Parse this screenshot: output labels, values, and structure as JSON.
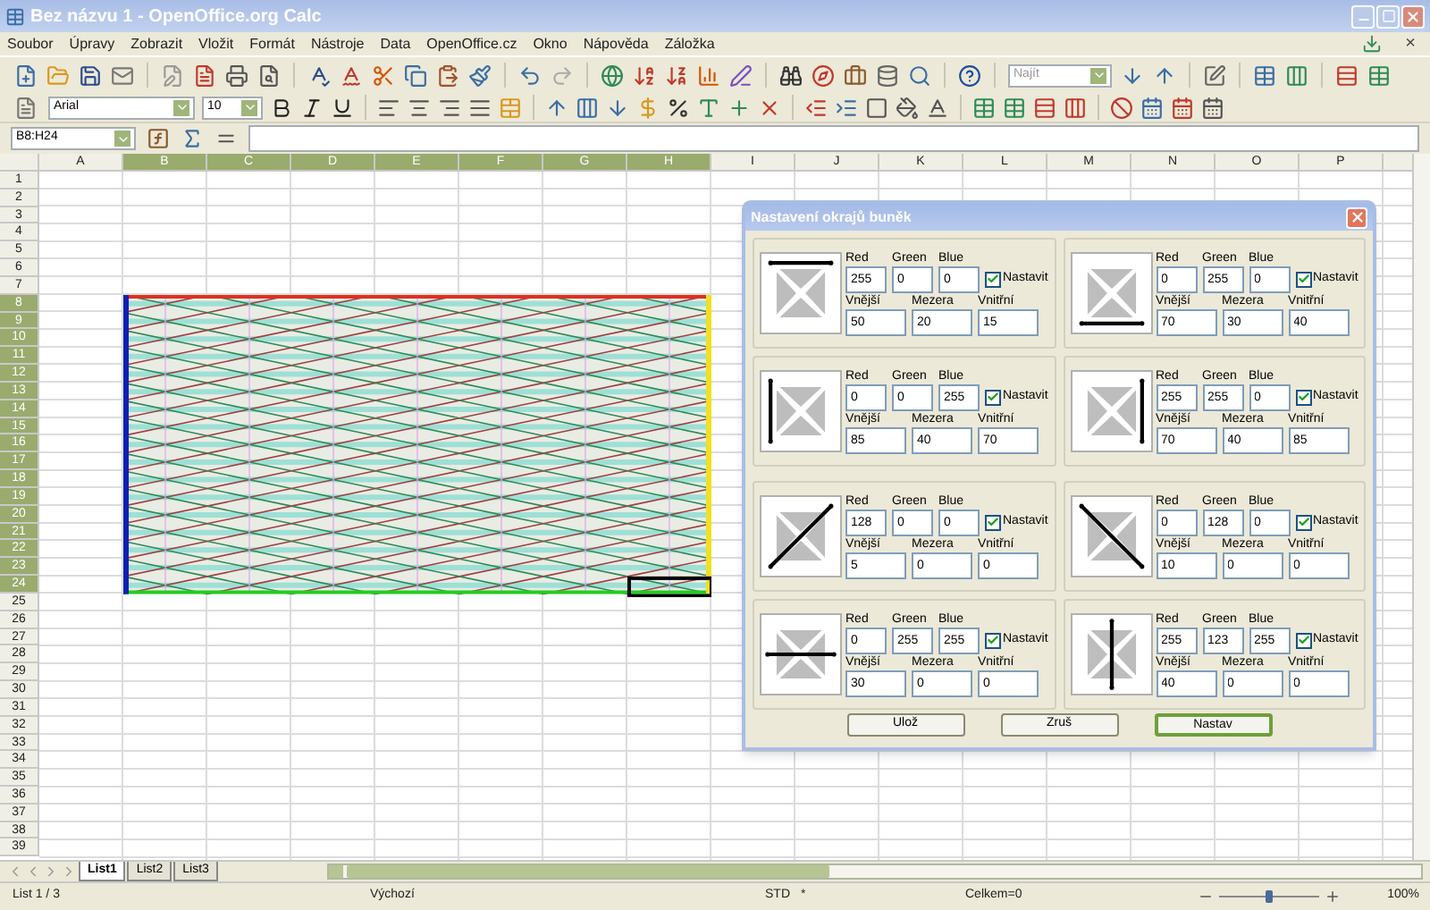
{
  "window": {
    "title": "Bez názvu 1 - OpenOffice.org Calc",
    "doc_close": "×"
  },
  "menu": [
    "Soubor",
    "Úpravy",
    "Zobrazit",
    "Vložit",
    "Formát",
    "Nástroje",
    "Data",
    "OpenOffice.cz",
    "Okno",
    "Nápověda",
    "Záložka"
  ],
  "toolbar": {
    "search_placeholder": "Najít",
    "font": "Arial",
    "size": "10"
  },
  "formula_bar": {
    "name_box": "B8:H24"
  },
  "columns": [
    {
      "label": "A",
      "selected": false
    },
    {
      "label": "B",
      "selected": true
    },
    {
      "label": "C",
      "selected": true
    },
    {
      "label": "D",
      "selected": true
    },
    {
      "label": "E",
      "selected": true
    },
    {
      "label": "F",
      "selected": true
    },
    {
      "label": "G",
      "selected": true
    },
    {
      "label": "H",
      "selected": true
    },
    {
      "label": "I",
      "selected": false
    },
    {
      "label": "J",
      "selected": false
    },
    {
      "label": "K",
      "selected": false
    },
    {
      "label": "L",
      "selected": false
    },
    {
      "label": "M",
      "selected": false
    },
    {
      "label": "N",
      "selected": false
    },
    {
      "label": "O",
      "selected": false
    },
    {
      "label": "P",
      "selected": false
    }
  ],
  "rows": [
    {
      "label": "1",
      "selected": false
    },
    {
      "label": "2",
      "selected": false
    },
    {
      "label": "3",
      "selected": false
    },
    {
      "label": "4",
      "selected": false
    },
    {
      "label": "5",
      "selected": false
    },
    {
      "label": "6",
      "selected": false
    },
    {
      "label": "7",
      "selected": false
    },
    {
      "label": "8",
      "selected": true
    },
    {
      "label": "9",
      "selected": true
    },
    {
      "label": "10",
      "selected": true
    },
    {
      "label": "11",
      "selected": true
    },
    {
      "label": "12",
      "selected": true
    },
    {
      "label": "13",
      "selected": true
    },
    {
      "label": "14",
      "selected": true
    },
    {
      "label": "15",
      "selected": true
    },
    {
      "label": "16",
      "selected": true
    },
    {
      "label": "17",
      "selected": true
    },
    {
      "label": "18",
      "selected": true
    },
    {
      "label": "19",
      "selected": true
    },
    {
      "label": "20",
      "selected": true
    },
    {
      "label": "21",
      "selected": true
    },
    {
      "label": "22",
      "selected": true
    },
    {
      "label": "23",
      "selected": true
    },
    {
      "label": "24",
      "selected": true
    },
    {
      "label": "25",
      "selected": false
    },
    {
      "label": "26",
      "selected": false
    },
    {
      "label": "27",
      "selected": false
    },
    {
      "label": "28",
      "selected": false
    },
    {
      "label": "29",
      "selected": false
    },
    {
      "label": "30",
      "selected": false
    },
    {
      "label": "31",
      "selected": false
    },
    {
      "label": "32",
      "selected": false
    },
    {
      "label": "33",
      "selected": false
    },
    {
      "label": "34",
      "selected": false
    },
    {
      "label": "35",
      "selected": false
    },
    {
      "label": "36",
      "selected": false
    },
    {
      "label": "37",
      "selected": false
    },
    {
      "label": "38",
      "selected": false
    },
    {
      "label": "39",
      "selected": false
    }
  ],
  "sheet_tabs": [
    {
      "label": "List1",
      "selected": true
    },
    {
      "label": "List2",
      "selected": false
    },
    {
      "label": "List3",
      "selected": false
    }
  ],
  "status_bar": {
    "sheet": "List 1 / 3",
    "style": "Výchozí",
    "mode": "STD",
    "modified": "*",
    "sum": "Celkem=0",
    "zoom": {
      "level": 0.5,
      "reading": "100%"
    }
  },
  "dialog": {
    "title": "Nastavení okrajů buněk",
    "panels": [
      {
        "kind": "top",
        "red": "255",
        "green": "0",
        "blue": "0",
        "checked": true,
        "outer": "50",
        "gap": "20",
        "inner": "15",
        "labels": [
          "Red",
          "Green",
          "Blue",
          "Nastavit",
          "Vnější",
          "Mezera",
          "Vnitřní"
        ]
      },
      {
        "kind": "bottom",
        "red": "0",
        "green": "255",
        "blue": "0",
        "checked": true,
        "outer": "70",
        "gap": "30",
        "inner": "40",
        "labels": [
          "Red",
          "Green",
          "Blue",
          "Nastavit",
          "Vnější",
          "Mezera",
          "Vnitřní"
        ]
      },
      {
        "kind": "left",
        "red": "0",
        "green": "0",
        "blue": "255",
        "checked": true,
        "outer": "85",
        "gap": "40",
        "inner": "70",
        "labels": [
          "Red",
          "Green",
          "Blue",
          "Nastavit",
          "Vnější",
          "Mezera",
          "Vnitřní"
        ]
      },
      {
        "kind": "right",
        "red": "255",
        "green": "255",
        "blue": "0",
        "checked": true,
        "outer": "70",
        "gap": "40",
        "inner": "85",
        "labels": [
          "Red",
          "Green",
          "Blue",
          "Nastavit",
          "Vnější",
          "Mezera",
          "Vnitřní"
        ]
      },
      {
        "kind": "diag_up",
        "red": "128",
        "green": "0",
        "blue": "0",
        "checked": true,
        "outer": "5",
        "gap": "0",
        "inner": "0",
        "labels": [
          "Red",
          "Green",
          "Blue",
          "Nastavit",
          "Vnější",
          "Mezera",
          "Vnitřní"
        ]
      },
      {
        "kind": "diag_down",
        "red": "0",
        "green": "128",
        "blue": "0",
        "checked": true,
        "outer": "10",
        "gap": "0",
        "inner": "0",
        "labels": [
          "Red",
          "Green",
          "Blue",
          "Nastavit",
          "Vnější",
          "Mezera",
          "Vnitřní"
        ]
      },
      {
        "kind": "horizontal",
        "red": "0",
        "green": "255",
        "blue": "255",
        "checked": true,
        "outer": "30",
        "gap": "0",
        "inner": "0",
        "labels": [
          "Red",
          "Green",
          "Blue",
          "Nastavit",
          "Vnější",
          "Mezera",
          "Vnitřní"
        ]
      },
      {
        "kind": "vertical",
        "red": "255",
        "green": "123",
        "blue": "255",
        "checked": true,
        "outer": "40",
        "gap": "0",
        "inner": "0",
        "labels": [
          "Red",
          "Green",
          "Blue",
          "Nastavit",
          "Vnější",
          "Mezera",
          "Vnitřní"
        ]
      }
    ],
    "buttons": [
      {
        "label": "Ulož",
        "focused": false
      },
      {
        "label": "Zruš",
        "focused": false
      },
      {
        "label": "Nastav",
        "focused": true
      }
    ]
  }
}
